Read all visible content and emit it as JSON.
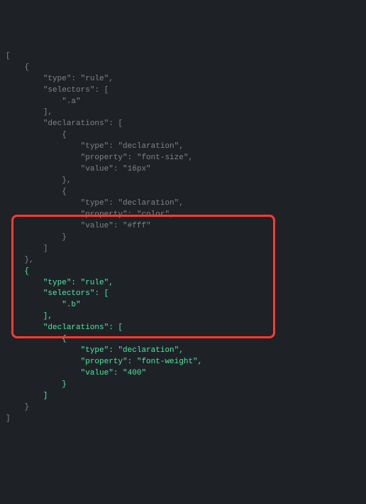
{
  "code": {
    "rules": [
      {
        "type": "rule",
        "selectors": [
          ".a"
        ],
        "declarations": [
          {
            "type": "declaration",
            "property": "font-size",
            "value": "16px"
          },
          {
            "type": "declaration",
            "property": "color",
            "value": "#fff"
          }
        ]
      },
      {
        "type": "rule",
        "selectors": [
          ".b"
        ],
        "declarations": [
          {
            "type": "declaration",
            "property": "font-weight",
            "value": "400"
          }
        ]
      }
    ]
  },
  "labels": {
    "type": "\"type\"",
    "selectors": "\"selectors\"",
    "declarations": "\"declarations\"",
    "property": "\"property\"",
    "value": "\"value\"",
    "rule": "\"rule\"",
    "declaration": "\"declaration\"",
    "sel_a": "\".a\"",
    "sel_b": "\".b\"",
    "fontsize": "\"font-size\"",
    "v16px": "\"16px\"",
    "color": "\"color\"",
    "vfff": "\"#fff\"",
    "fontweight": "\"font-weight\"",
    "v400": "\"400\""
  }
}
